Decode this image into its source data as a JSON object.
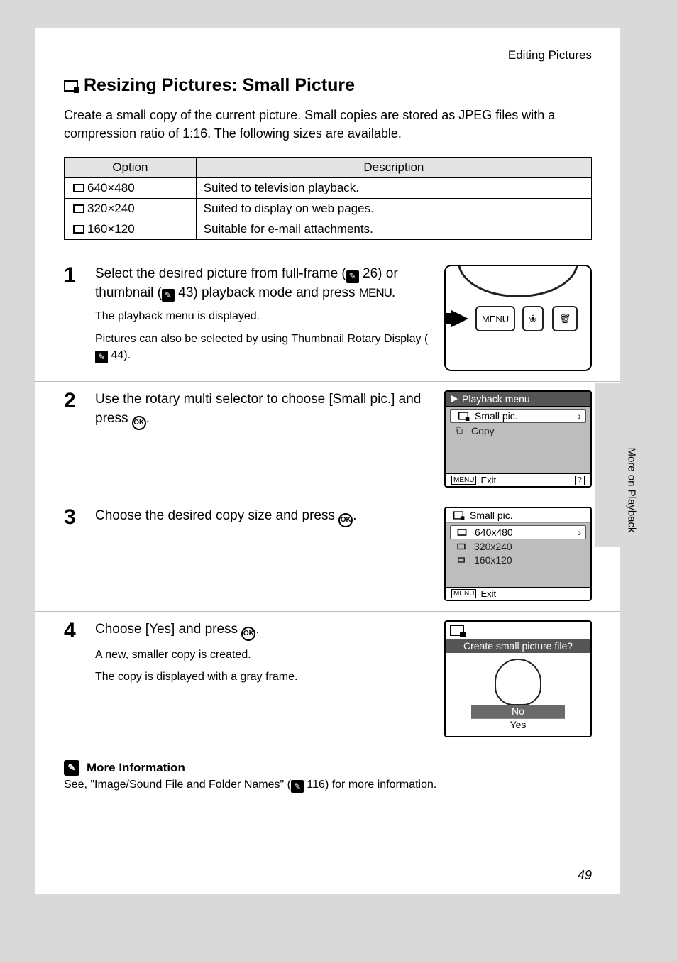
{
  "header": {
    "section": "Editing Pictures"
  },
  "title": "Resizing Pictures: Small Picture",
  "intro": "Create a small copy of the current picture. Small copies are stored as JPEG files with a compression ratio of 1:16. The following sizes are available.",
  "table": {
    "headers": {
      "option": "Option",
      "description": "Description"
    },
    "rows": [
      {
        "option": "640×480",
        "description": "Suited to television playback."
      },
      {
        "option": "320×240",
        "description": "Suited to display on web pages."
      },
      {
        "option": "160×120",
        "description": "Suitable for e-mail attachments."
      }
    ]
  },
  "steps": {
    "s1": {
      "num": "1",
      "text_a": "Select the desired picture from full-frame (",
      "ref1": "26",
      "text_b": ") or thumbnail (",
      "ref2": "43",
      "text_c": ") playback mode and press ",
      "menu": "MENU",
      "text_d": ".",
      "sub1": "The playback menu is displayed.",
      "sub2_a": "Pictures can also be selected by using Thumbnail Rotary Display (",
      "sub2_ref": "44",
      "sub2_b": ")."
    },
    "s2": {
      "num": "2",
      "text_a": "Use the rotary multi selector to choose [Small pic.] and press ",
      "ok": "OK",
      "text_b": ".",
      "screen": {
        "title": "Playback menu",
        "item1": "Small pic.",
        "item2": "Copy",
        "exit": "Exit",
        "menu_tag": "MENU"
      }
    },
    "s3": {
      "num": "3",
      "text_a": "Choose the desired copy size and press ",
      "ok": "OK",
      "text_b": ".",
      "screen": {
        "title": "Small pic.",
        "opt1": "640x480",
        "opt2": "320x240",
        "opt3": "160x120",
        "exit": "Exit",
        "menu_tag": "MENU"
      }
    },
    "s4": {
      "num": "4",
      "text_a": "Choose [Yes] and press ",
      "ok": "OK",
      "text_b": ".",
      "sub1": "A new, smaller copy is created.",
      "sub2": "The copy is displayed with a gray frame.",
      "screen": {
        "question": "Create small picture file?",
        "no": "No",
        "yes": "Yes"
      }
    }
  },
  "illus1": {
    "menu_btn": "MENU"
  },
  "side_tab": "More on Playback",
  "more_info": {
    "heading": "More Information",
    "body_a": "See, \"Image/Sound File and Folder Names\" (",
    "ref": "116",
    "body_b": ") for more information."
  },
  "page_number": "49"
}
